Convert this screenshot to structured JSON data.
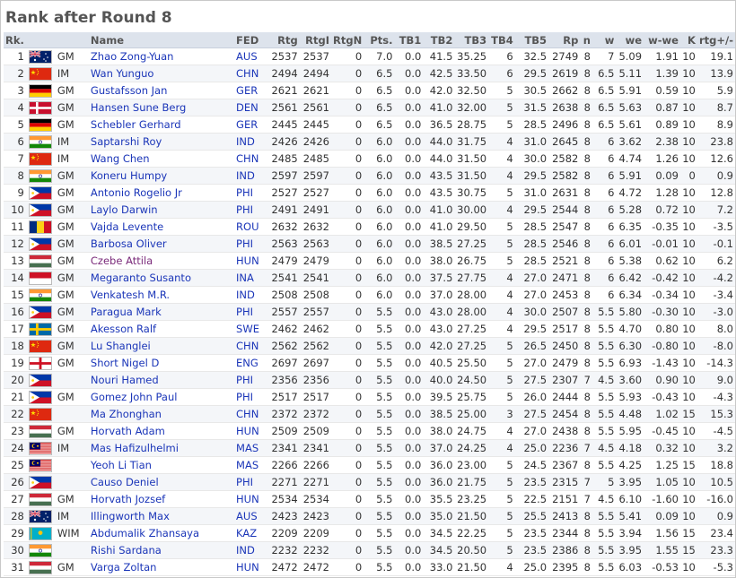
{
  "title": "Rank after Round 8",
  "columns": [
    "Rk.",
    "",
    "",
    "Name",
    "FED",
    "Rtg",
    "RtgI",
    "RtgN",
    "Pts.",
    "TB1",
    "TB2",
    "TB3",
    "TB4",
    "TB5",
    "Rp",
    "n",
    "w",
    "we",
    "w-we",
    "K",
    "rtg+/-"
  ],
  "rows": [
    [
      "1",
      "aus",
      "GM",
      "Zhao Zong-Yuan",
      "AUS",
      "2537",
      "2537",
      "0",
      "7.0",
      "0.0",
      "41.5",
      "35.25",
      "6",
      "32.5",
      "2749",
      "8",
      "7",
      "5.09",
      "1.91",
      "10",
      "19.1"
    ],
    [
      "2",
      "chn",
      "IM",
      "Wan Yunguo",
      "CHN",
      "2494",
      "2494",
      "0",
      "6.5",
      "0.0",
      "42.5",
      "33.50",
      "6",
      "29.5",
      "2619",
      "8",
      "6.5",
      "5.11",
      "1.39",
      "10",
      "13.9"
    ],
    [
      "3",
      "ger",
      "GM",
      "Gustafsson Jan",
      "GER",
      "2621",
      "2621",
      "0",
      "6.5",
      "0.0",
      "42.0",
      "32.50",
      "5",
      "30.5",
      "2662",
      "8",
      "6.5",
      "5.91",
      "0.59",
      "10",
      "5.9"
    ],
    [
      "4",
      "den",
      "GM",
      "Hansen Sune Berg",
      "DEN",
      "2561",
      "2561",
      "0",
      "6.5",
      "0.0",
      "41.0",
      "32.00",
      "5",
      "31.5",
      "2638",
      "8",
      "6.5",
      "5.63",
      "0.87",
      "10",
      "8.7"
    ],
    [
      "5",
      "ger",
      "GM",
      "Schebler Gerhard",
      "GER",
      "2445",
      "2445",
      "0",
      "6.5",
      "0.0",
      "36.5",
      "28.75",
      "5",
      "28.5",
      "2496",
      "8",
      "6.5",
      "5.61",
      "0.89",
      "10",
      "8.9"
    ],
    [
      "6",
      "ind",
      "IM",
      "Saptarshi Roy",
      "IND",
      "2426",
      "2426",
      "0",
      "6.0",
      "0.0",
      "44.0",
      "31.75",
      "4",
      "31.0",
      "2645",
      "8",
      "6",
      "3.62",
      "2.38",
      "10",
      "23.8"
    ],
    [
      "7",
      "chn",
      "IM",
      "Wang Chen",
      "CHN",
      "2485",
      "2485",
      "0",
      "6.0",
      "0.0",
      "44.0",
      "31.50",
      "4",
      "30.0",
      "2582",
      "8",
      "6",
      "4.74",
      "1.26",
      "10",
      "12.6"
    ],
    [
      "8",
      "ind",
      "GM",
      "Koneru Humpy",
      "IND",
      "2597",
      "2597",
      "0",
      "6.0",
      "0.0",
      "43.5",
      "31.50",
      "4",
      "29.5",
      "2582",
      "8",
      "6",
      "5.91",
      "0.09",
      "0",
      "0.9"
    ],
    [
      "9",
      "phi",
      "GM",
      "Antonio Rogelio Jr",
      "PHI",
      "2527",
      "2527",
      "0",
      "6.0",
      "0.0",
      "43.5",
      "30.75",
      "5",
      "31.0",
      "2631",
      "8",
      "6",
      "4.72",
      "1.28",
      "10",
      "12.8"
    ],
    [
      "10",
      "phi",
      "GM",
      "Laylo Darwin",
      "PHI",
      "2491",
      "2491",
      "0",
      "6.0",
      "0.0",
      "41.0",
      "30.00",
      "4",
      "29.5",
      "2544",
      "8",
      "6",
      "5.28",
      "0.72",
      "10",
      "7.2"
    ],
    [
      "11",
      "rou",
      "GM",
      "Vajda Levente",
      "ROU",
      "2632",
      "2632",
      "0",
      "6.0",
      "0.0",
      "41.0",
      "29.50",
      "5",
      "28.5",
      "2547",
      "8",
      "6",
      "6.35",
      "-0.35",
      "10",
      "-3.5"
    ],
    [
      "12",
      "phi",
      "GM",
      "Barbosa Oliver",
      "PHI",
      "2563",
      "2563",
      "0",
      "6.0",
      "0.0",
      "38.5",
      "27.25",
      "5",
      "28.5",
      "2546",
      "8",
      "6",
      "6.01",
      "-0.01",
      "10",
      "-0.1"
    ],
    [
      "13",
      "hun",
      "GM",
      "Czebe Attila",
      "HUN",
      "2479",
      "2479",
      "0",
      "6.0",
      "0.0",
      "38.0",
      "26.75",
      "5",
      "28.5",
      "2521",
      "8",
      "6",
      "5.38",
      "0.62",
      "10",
      "6.2"
    ],
    [
      "14",
      "ina",
      "GM",
      "Megaranto Susanto",
      "INA",
      "2541",
      "2541",
      "0",
      "6.0",
      "0.0",
      "37.5",
      "27.75",
      "4",
      "27.0",
      "2471",
      "8",
      "6",
      "6.42",
      "-0.42",
      "10",
      "-4.2"
    ],
    [
      "15",
      "ind",
      "GM",
      "Venkatesh M.R.",
      "IND",
      "2508",
      "2508",
      "0",
      "6.0",
      "0.0",
      "37.0",
      "28.00",
      "4",
      "27.0",
      "2453",
      "8",
      "6",
      "6.34",
      "-0.34",
      "10",
      "-3.4"
    ],
    [
      "16",
      "phi",
      "GM",
      "Paragua Mark",
      "PHI",
      "2557",
      "2557",
      "0",
      "5.5",
      "0.0",
      "43.0",
      "28.00",
      "4",
      "30.0",
      "2507",
      "8",
      "5.5",
      "5.80",
      "-0.30",
      "10",
      "-3.0"
    ],
    [
      "17",
      "swe",
      "GM",
      "Akesson Ralf",
      "SWE",
      "2462",
      "2462",
      "0",
      "5.5",
      "0.0",
      "43.0",
      "27.25",
      "4",
      "29.5",
      "2517",
      "8",
      "5.5",
      "4.70",
      "0.80",
      "10",
      "8.0"
    ],
    [
      "18",
      "chn",
      "GM",
      "Lu Shanglei",
      "CHN",
      "2562",
      "2562",
      "0",
      "5.5",
      "0.0",
      "42.0",
      "27.25",
      "5",
      "26.5",
      "2450",
      "8",
      "5.5",
      "6.30",
      "-0.80",
      "10",
      "-8.0"
    ],
    [
      "19",
      "eng",
      "GM",
      "Short Nigel D",
      "ENG",
      "2697",
      "2697",
      "0",
      "5.5",
      "0.0",
      "40.5",
      "25.50",
      "5",
      "27.0",
      "2479",
      "8",
      "5.5",
      "6.93",
      "-1.43",
      "10",
      "-14.3"
    ],
    [
      "20",
      "phi",
      "",
      "Nouri Hamed",
      "PHI",
      "2356",
      "2356",
      "0",
      "5.5",
      "0.0",
      "40.0",
      "24.50",
      "5",
      "27.5",
      "2307",
      "7",
      "4.5",
      "3.60",
      "0.90",
      "10",
      "9.0"
    ],
    [
      "21",
      "phi",
      "GM",
      "Gomez John Paul",
      "PHI",
      "2517",
      "2517",
      "0",
      "5.5",
      "0.0",
      "39.5",
      "25.75",
      "5",
      "26.0",
      "2444",
      "8",
      "5.5",
      "5.93",
      "-0.43",
      "10",
      "-4.3"
    ],
    [
      "22",
      "chn",
      "",
      "Ma Zhonghan",
      "CHN",
      "2372",
      "2372",
      "0",
      "5.5",
      "0.0",
      "38.5",
      "25.00",
      "3",
      "27.5",
      "2454",
      "8",
      "5.5",
      "4.48",
      "1.02",
      "15",
      "15.3"
    ],
    [
      "23",
      "hun",
      "GM",
      "Horvath Adam",
      "HUN",
      "2509",
      "2509",
      "0",
      "5.5",
      "0.0",
      "38.0",
      "24.75",
      "4",
      "27.0",
      "2438",
      "8",
      "5.5",
      "5.95",
      "-0.45",
      "10",
      "-4.5"
    ],
    [
      "24",
      "mas",
      "IM",
      "Mas Hafizulhelmi",
      "MAS",
      "2341",
      "2341",
      "0",
      "5.5",
      "0.0",
      "37.0",
      "24.25",
      "4",
      "25.0",
      "2236",
      "7",
      "4.5",
      "4.18",
      "0.32",
      "10",
      "3.2"
    ],
    [
      "25",
      "mas",
      "",
      "Yeoh Li Tian",
      "MAS",
      "2266",
      "2266",
      "0",
      "5.5",
      "0.0",
      "36.0",
      "23.00",
      "5",
      "24.5",
      "2367",
      "8",
      "5.5",
      "4.25",
      "1.25",
      "15",
      "18.8"
    ],
    [
      "26",
      "phi",
      "",
      "Causo Deniel",
      "PHI",
      "2271",
      "2271",
      "0",
      "5.5",
      "0.0",
      "36.0",
      "21.75",
      "5",
      "23.5",
      "2315",
      "7",
      "5",
      "3.95",
      "1.05",
      "10",
      "10.5"
    ],
    [
      "27",
      "hun",
      "GM",
      "Horvath Jozsef",
      "HUN",
      "2534",
      "2534",
      "0",
      "5.5",
      "0.0",
      "35.5",
      "23.25",
      "5",
      "22.5",
      "2151",
      "7",
      "4.5",
      "6.10",
      "-1.60",
      "10",
      "-16.0"
    ],
    [
      "28",
      "aus",
      "IM",
      "Illingworth Max",
      "AUS",
      "2423",
      "2423",
      "0",
      "5.5",
      "0.0",
      "35.0",
      "21.50",
      "5",
      "25.5",
      "2413",
      "8",
      "5.5",
      "5.41",
      "0.09",
      "10",
      "0.9"
    ],
    [
      "29",
      "kaz",
      "WIM",
      "Abdumalik Zhansaya",
      "KAZ",
      "2209",
      "2209",
      "0",
      "5.5",
      "0.0",
      "34.5",
      "22.25",
      "5",
      "23.5",
      "2344",
      "8",
      "5.5",
      "3.94",
      "1.56",
      "15",
      "23.4"
    ],
    [
      "30",
      "ind",
      "",
      "Rishi Sardana",
      "IND",
      "2232",
      "2232",
      "0",
      "5.5",
      "0.0",
      "34.5",
      "20.50",
      "5",
      "23.5",
      "2386",
      "8",
      "5.5",
      "3.95",
      "1.55",
      "15",
      "23.3"
    ],
    [
      "31",
      "hun",
      "GM",
      "Varga Zoltan",
      "HUN",
      "2472",
      "2472",
      "0",
      "5.5",
      "0.0",
      "33.0",
      "21.50",
      "4",
      "25.0",
      "2395",
      "8",
      "5.5",
      "6.03",
      "-0.53",
      "10",
      "-5.3"
    ]
  ],
  "visited_rows": [
    13
  ],
  "colors": {
    "link": "#1a35b8",
    "visited": "#7a2a7a",
    "header_bg": "#dde3ec",
    "title": "#555555"
  }
}
